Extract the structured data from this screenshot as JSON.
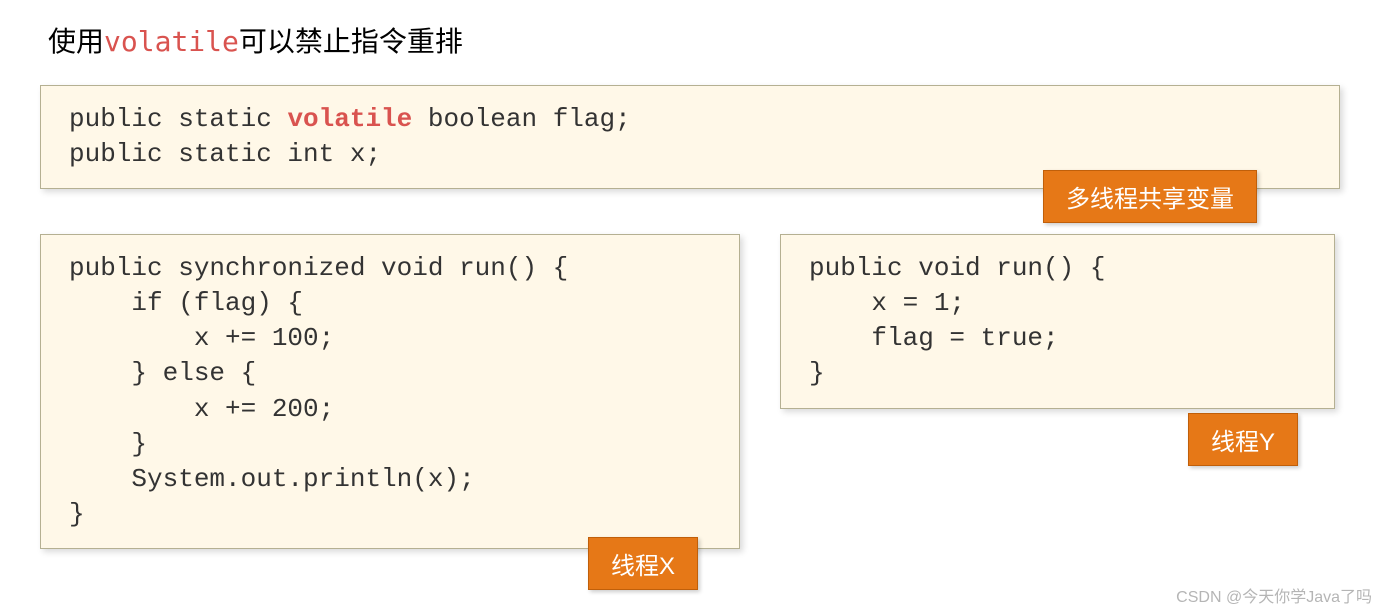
{
  "title": {
    "prefix": "使用",
    "highlight": "volatile",
    "suffix": "可以禁止指令重排"
  },
  "code_top": {
    "line1_pre": "public static ",
    "line1_kw": "volatile",
    "line1_post": " boolean flag;",
    "line2": "public static int x;"
  },
  "code_left": "public synchronized void run() {\n    if (flag) {\n        x += 100;\n    } else {\n        x += 200;\n    }\n    System.out.println(x);\n}",
  "code_right": "public void run() {\n    x = 1;\n    flag = true;\n}",
  "badges": {
    "shared": "多线程共享变量",
    "threadX": "线程X",
    "threadY": "线程Y"
  },
  "watermark": "CSDN @今天你学Java了吗"
}
